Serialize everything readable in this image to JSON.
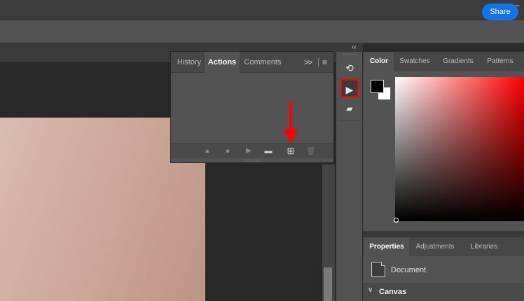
{
  "window": {
    "minimize_glyph": "—"
  },
  "optionsbar": {
    "share_label": "Share"
  },
  "actions_panel": {
    "tabs": [
      {
        "label": "History"
      },
      {
        "label": "Actions"
      },
      {
        "label": "Comments"
      }
    ],
    "active_tab": "Actions",
    "more_glyph": ">>",
    "menu_glyph": "≡",
    "footer_buttons": [
      {
        "name": "stop-icon",
        "glyph": "■"
      },
      {
        "name": "record-icon",
        "glyph": "●"
      },
      {
        "name": "play-icon",
        "glyph": "▶"
      },
      {
        "name": "folder-icon",
        "glyph": "▬"
      },
      {
        "name": "new-action-icon",
        "glyph": "⊞"
      },
      {
        "name": "trash-icon",
        "glyph": "🗑"
      }
    ]
  },
  "dock": {
    "collapse_glyph": "‹‹",
    "icons": [
      {
        "name": "history-icon",
        "glyph": "⟲"
      },
      {
        "name": "actions-icon",
        "glyph": "▶"
      },
      {
        "name": "comments-icon",
        "glyph": "▰"
      }
    ]
  },
  "color_panel": {
    "tabs": [
      {
        "label": "Color"
      },
      {
        "label": "Swatches"
      },
      {
        "label": "Gradients"
      },
      {
        "label": "Patterns"
      }
    ],
    "active_tab": "Color",
    "foreground": "#000000",
    "background": "#ffffff",
    "hue": "#ff0000"
  },
  "properties_panel": {
    "tabs": [
      {
        "label": "Properties"
      },
      {
        "label": "Adjustments"
      },
      {
        "label": "Libraries"
      }
    ],
    "active_tab": "Properties",
    "document_label": "Document",
    "section_label": "Canvas",
    "section_chevron": "∨"
  },
  "colors": {
    "accent": "#1473e6",
    "highlight": "#ff0000"
  }
}
